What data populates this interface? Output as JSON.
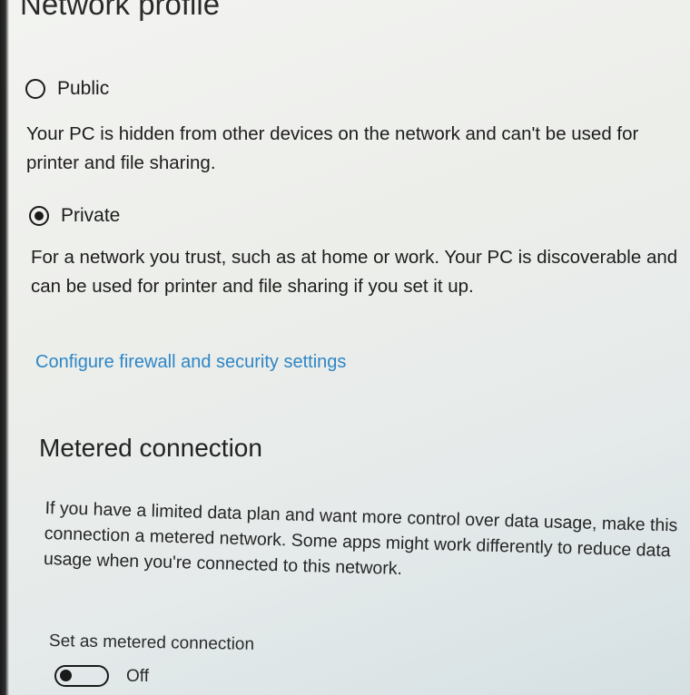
{
  "section": {
    "title": "Network profile"
  },
  "profiles": [
    {
      "label": "Public",
      "selected": false,
      "description": "Your PC is hidden from other devices on the network and can't be used for printer and file sharing."
    },
    {
      "label": "Private",
      "selected": true,
      "description": "For a network you trust, such as at home or work. Your PC is discoverable and can be used for printer and file sharing if you set it up."
    }
  ],
  "firewall_link": "Configure firewall and security settings",
  "metered": {
    "title": "Metered connection",
    "description": "If you have a limited data plan and want more control over data usage, make this connection a metered network. Some apps might work differently to reduce data usage when you're connected to this network.",
    "toggle_label": "Set as metered connection",
    "toggle_state": "Off",
    "toggle_on": false
  },
  "colors": {
    "link": "#2e86c6",
    "text": "#1d1d1d"
  }
}
